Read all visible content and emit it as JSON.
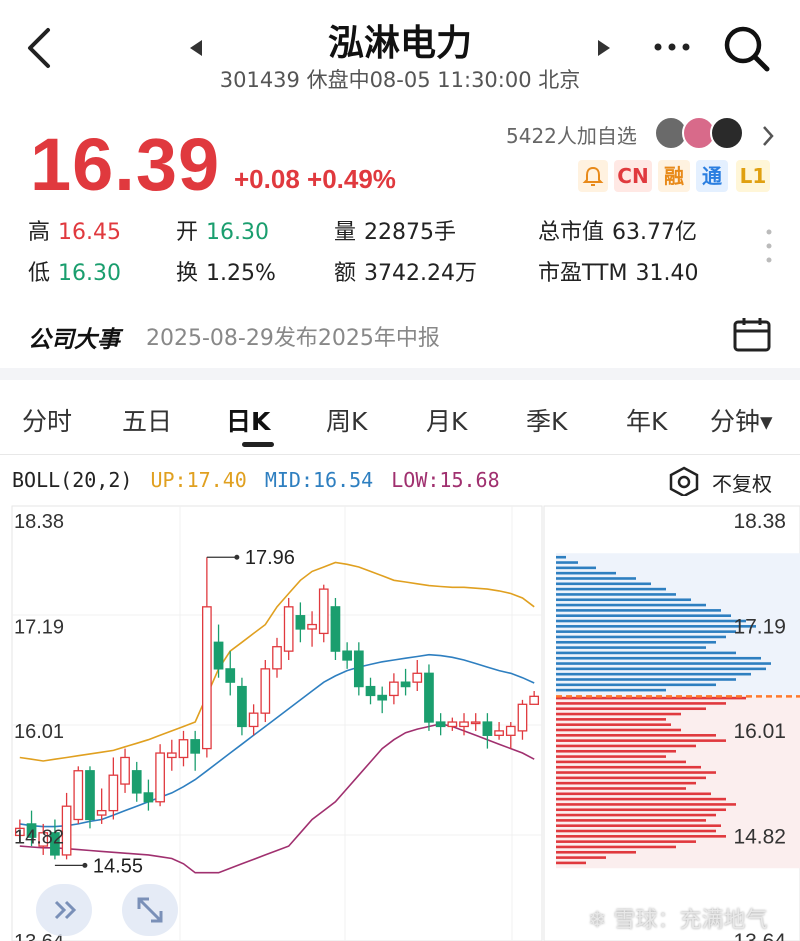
{
  "header": {
    "title": "泓淋电力",
    "subtitle": "301439 休盘中08-05 11:30:00 北京"
  },
  "quote": {
    "price": "16.39",
    "change": "+0.08 +0.49%",
    "followers": "5422人加自选",
    "badges": [
      "CN",
      "融",
      "通",
      "L1"
    ]
  },
  "stats": {
    "high_label": "高",
    "high": "16.45",
    "low_label": "低",
    "low": "16.30",
    "open_label": "开",
    "open": "16.30",
    "turnover_label": "换",
    "turnover": "1.25%",
    "volume_label": "量",
    "volume": "22875手",
    "amount_label": "额",
    "amount": "3742.24万",
    "mcap_label": "总市值",
    "mcap": "63.77亿",
    "pe_label": "市盈TTM",
    "pe": "31.40"
  },
  "events": {
    "label": "公司大事",
    "text": "2025-08-29发布2025年中报"
  },
  "tabs": [
    "分时",
    "五日",
    "日K",
    "周K",
    "月K",
    "季K",
    "年K",
    "分钟▾"
  ],
  "active_tab": "日K",
  "indicator": {
    "name": "BOLL(20,2)",
    "up": "UP:17.40",
    "mid": "MID:16.54",
    "low": "LOW:15.68",
    "adjust": "不复权"
  },
  "colors": {
    "up": "#e0393e",
    "down": "#1a9e6e",
    "upper": "#e0a020",
    "mid": "#2e7fc0",
    "lower": "#a0306f"
  },
  "chart_data": {
    "type": "candlestick",
    "y_ticks": [
      "18.38",
      "17.19",
      "16.01",
      "14.82",
      "13.64"
    ],
    "ylim": [
      13.64,
      18.38
    ],
    "max_label": "17.96",
    "min_label": "14.55",
    "candles": [
      {
        "o": 14.82,
        "c": 14.9,
        "h": 15.0,
        "l": 14.75
      },
      {
        "o": 14.95,
        "c": 14.8,
        "h": 15.1,
        "l": 14.7
      },
      {
        "o": 14.7,
        "c": 14.85,
        "h": 14.95,
        "l": 14.6
      },
      {
        "o": 14.85,
        "c": 14.6,
        "h": 15.0,
        "l": 14.55
      },
      {
        "o": 14.6,
        "c": 15.15,
        "h": 15.3,
        "l": 14.55
      },
      {
        "o": 15.0,
        "c": 15.55,
        "h": 15.6,
        "l": 14.95
      },
      {
        "o": 15.55,
        "c": 15.0,
        "h": 15.6,
        "l": 14.9
      },
      {
        "o": 15.05,
        "c": 15.1,
        "h": 15.35,
        "l": 14.95
      },
      {
        "o": 15.1,
        "c": 15.5,
        "h": 15.7,
        "l": 15.0
      },
      {
        "o": 15.4,
        "c": 15.7,
        "h": 15.8,
        "l": 15.3
      },
      {
        "o": 15.55,
        "c": 15.3,
        "h": 15.65,
        "l": 15.2
      },
      {
        "o": 15.3,
        "c": 15.2,
        "h": 15.45,
        "l": 15.1
      },
      {
        "o": 15.2,
        "c": 15.75,
        "h": 15.85,
        "l": 15.15
      },
      {
        "o": 15.7,
        "c": 15.75,
        "h": 15.9,
        "l": 15.55
      },
      {
        "o": 15.7,
        "c": 15.9,
        "h": 16.0,
        "l": 15.6
      },
      {
        "o": 15.9,
        "c": 15.75,
        "h": 16.0,
        "l": 15.55
      },
      {
        "o": 15.8,
        "c": 17.4,
        "h": 17.96,
        "l": 15.7
      },
      {
        "o": 17.0,
        "c": 16.7,
        "h": 17.2,
        "l": 16.6
      },
      {
        "o": 16.7,
        "c": 16.55,
        "h": 16.9,
        "l": 16.4
      },
      {
        "o": 16.5,
        "c": 16.05,
        "h": 16.6,
        "l": 15.95
      },
      {
        "o": 16.05,
        "c": 16.2,
        "h": 16.3,
        "l": 15.95
      },
      {
        "o": 16.2,
        "c": 16.7,
        "h": 16.8,
        "l": 16.1
      },
      {
        "o": 16.7,
        "c": 16.95,
        "h": 17.05,
        "l": 16.6
      },
      {
        "o": 16.9,
        "c": 17.4,
        "h": 17.5,
        "l": 16.8
      },
      {
        "o": 17.3,
        "c": 17.15,
        "h": 17.45,
        "l": 17.0
      },
      {
        "o": 17.15,
        "c": 17.2,
        "h": 17.35,
        "l": 16.95
      },
      {
        "o": 17.1,
        "c": 17.6,
        "h": 17.65,
        "l": 17.0
      },
      {
        "o": 17.4,
        "c": 16.9,
        "h": 17.5,
        "l": 16.8
      },
      {
        "o": 16.9,
        "c": 16.8,
        "h": 17.0,
        "l": 16.7
      },
      {
        "o": 16.9,
        "c": 16.5,
        "h": 17.0,
        "l": 16.4
      },
      {
        "o": 16.5,
        "c": 16.4,
        "h": 16.6,
        "l": 16.3
      },
      {
        "o": 16.4,
        "c": 16.35,
        "h": 16.5,
        "l": 16.2
      },
      {
        "o": 16.4,
        "c": 16.55,
        "h": 16.65,
        "l": 16.3
      },
      {
        "o": 16.55,
        "c": 16.5,
        "h": 16.7,
        "l": 16.4
      },
      {
        "o": 16.55,
        "c": 16.65,
        "h": 16.8,
        "l": 16.45
      },
      {
        "o": 16.65,
        "c": 16.1,
        "h": 16.75,
        "l": 16.0
      },
      {
        "o": 16.1,
        "c": 16.05,
        "h": 16.2,
        "l": 15.95
      },
      {
        "o": 16.05,
        "c": 16.1,
        "h": 16.15,
        "l": 16.0
      },
      {
        "o": 16.05,
        "c": 16.1,
        "h": 16.2,
        "l": 15.95
      },
      {
        "o": 16.1,
        "c": 16.1,
        "h": 16.2,
        "l": 16.0
      },
      {
        "o": 16.1,
        "c": 15.95,
        "h": 16.2,
        "l": 15.8
      },
      {
        "o": 15.95,
        "c": 16.0,
        "h": 16.1,
        "l": 15.9
      },
      {
        "o": 15.95,
        "c": 16.05,
        "h": 16.1,
        "l": 15.8
      },
      {
        "o": 16.0,
        "c": 16.3,
        "h": 16.35,
        "l": 15.9
      },
      {
        "o": 16.3,
        "c": 16.39,
        "h": 16.45,
        "l": 16.3
      }
    ],
    "upper": [
      15.7,
      15.68,
      15.66,
      15.68,
      15.7,
      15.72,
      15.74,
      15.76,
      15.78,
      15.82,
      15.86,
      15.9,
      15.95,
      16.0,
      16.05,
      16.1,
      16.4,
      16.7,
      16.9,
      17.0,
      17.1,
      17.2,
      17.4,
      17.55,
      17.7,
      17.8,
      17.85,
      17.9,
      17.88,
      17.85,
      17.8,
      17.75,
      17.7,
      17.68,
      17.66,
      17.64,
      17.63,
      17.62,
      17.62,
      17.61,
      17.6,
      17.58,
      17.55,
      17.5,
      17.4
    ],
    "mid": [
      14.95,
      14.93,
      14.92,
      14.92,
      14.93,
      14.95,
      14.98,
      15.0,
      15.05,
      15.1,
      15.15,
      15.2,
      15.25,
      15.3,
      15.37,
      15.45,
      15.55,
      15.65,
      15.75,
      15.85,
      15.95,
      16.05,
      16.15,
      16.25,
      16.35,
      16.45,
      16.55,
      16.62,
      16.68,
      16.72,
      16.75,
      16.78,
      16.8,
      16.82,
      16.84,
      16.86,
      16.85,
      16.83,
      16.8,
      16.76,
      16.72,
      16.68,
      16.65,
      16.6,
      16.54
    ],
    "lower": [
      14.7,
      14.69,
      14.68,
      14.68,
      14.67,
      14.66,
      14.65,
      14.64,
      14.63,
      14.62,
      14.61,
      14.6,
      14.58,
      14.56,
      14.5,
      14.4,
      14.4,
      14.4,
      14.45,
      14.5,
      14.55,
      14.6,
      14.65,
      14.7,
      14.85,
      15.0,
      15.1,
      15.2,
      15.35,
      15.5,
      15.65,
      15.8,
      15.9,
      15.98,
      16.02,
      16.05,
      16.08,
      16.05,
      16.0,
      15.95,
      15.9,
      15.85,
      15.8,
      15.75,
      15.68
    ],
    "profile_top": [
      17.96,
      17.9,
      17.84,
      17.78,
      17.72,
      17.66,
      17.6,
      17.54,
      17.48,
      17.42,
      17.36,
      17.3,
      17.24,
      17.18,
      17.12,
      17.06,
      17.0,
      16.94,
      16.88,
      16.82,
      16.76,
      16.7,
      16.64,
      16.58,
      16.52,
      16.46
    ],
    "profile_top_w": [
      10,
      22,
      40,
      60,
      80,
      95,
      110,
      120,
      135,
      150,
      165,
      175,
      190,
      200,
      180,
      170,
      160,
      150,
      180,
      205,
      215,
      210,
      195,
      180,
      160,
      110
    ],
    "profile_bot": [
      16.37,
      16.31,
      16.25,
      16.19,
      16.13,
      16.07,
      16.01,
      15.95,
      15.89,
      15.83,
      15.77,
      15.71,
      15.65,
      15.59,
      15.53,
      15.47,
      15.41,
      15.35,
      15.29,
      15.23,
      15.17,
      15.11,
      15.05,
      14.99,
      14.93,
      14.87,
      14.81,
      14.75,
      14.69,
      14.63,
      14.57,
      14.51
    ],
    "profile_bot_w": [
      190,
      170,
      150,
      125,
      110,
      115,
      125,
      160,
      170,
      140,
      120,
      110,
      130,
      145,
      160,
      150,
      140,
      130,
      155,
      170,
      180,
      170,
      160,
      150,
      165,
      160,
      170,
      140,
      120,
      80,
      50,
      30
    ],
    "last_price": 16.39
  },
  "watermark": "雪球：充满地气"
}
